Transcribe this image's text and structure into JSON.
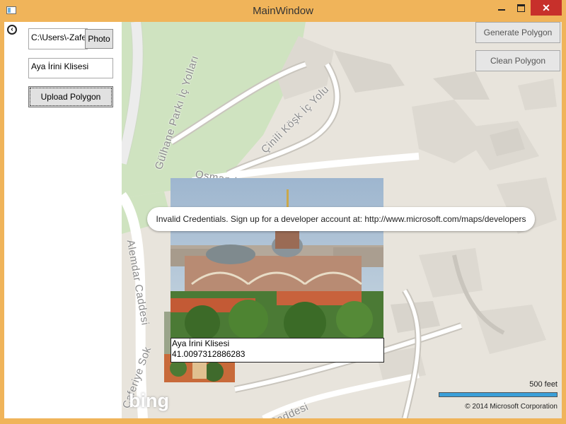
{
  "window": {
    "title": "MainWindow",
    "close_glyph": "✕"
  },
  "sidebar": {
    "back_glyph": "‹",
    "path_value": "C:\\Users\\-Zafer",
    "photo_label": "Photo",
    "name_value": "Aya İrini Klisesi",
    "upload_label": "Upload Polygon"
  },
  "map": {
    "streets": [
      "Gülhane Parkı İç Yolları",
      "Osman Hamdi Bey Yo",
      "Çinili Köşk İç Yolu",
      "Alemdar Caddesi",
      "Caferiye Sok",
      "Caddesi"
    ],
    "generate_label": "Generate Polygon",
    "clean_label": "Clean Polygon",
    "error_message": "Invalid Credentials. Sign up for a developer account at: http://www.microsoft.com/maps/developers",
    "pin": {
      "title": "Aya İrini Klisesi",
      "value": "41.0097312886283"
    },
    "scale_label": "500 feet",
    "copyright": "© 2014 Microsoft Corporation",
    "brand": "bing"
  }
}
